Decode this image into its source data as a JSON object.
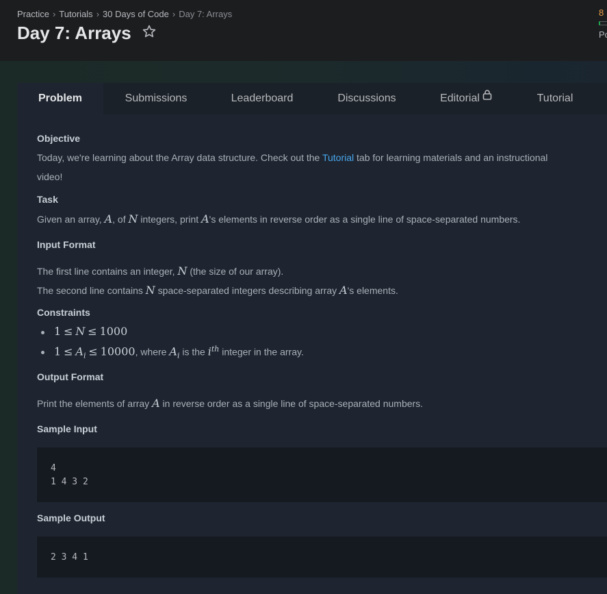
{
  "breadcrumb": {
    "items": [
      "Practice",
      "Tutorials",
      "30 Days of Code"
    ],
    "current": "Day 7: Arrays"
  },
  "title": "Day 7: Arrays",
  "stats": {
    "rank_fragment": "8",
    "points_fragment": "Po"
  },
  "tabs": [
    {
      "label": "Problem",
      "active": true
    },
    {
      "label": "Submissions"
    },
    {
      "label": "Leaderboard"
    },
    {
      "label": "Discussions"
    },
    {
      "label": "Editorial",
      "icon": "lock-icon"
    },
    {
      "label": "Tutorial"
    }
  ],
  "problem": {
    "objective": {
      "heading": "Objective",
      "text_before": "Today, we're learning about the Array data structure. Check out the ",
      "link": "Tutorial",
      "text_after": " tab for learning materials and an instructional",
      "text_line2": "video!"
    },
    "task": {
      "heading": "Task",
      "t1": "Given an array, ",
      "m1": "A",
      "t2": ", of ",
      "m2": "N",
      "t3": " integers, print ",
      "m3": "A",
      "t4": "'s elements in reverse order as a single line of space-separated numbers."
    },
    "input_format": {
      "heading": "Input Format",
      "l1a": "The first line contains an integer, ",
      "l1m": "N",
      "l1b": " (the size of our array).",
      "l2a": "The second line contains ",
      "l2m": "N",
      "l2b": " space-separated integers describing array ",
      "l2m2": "A",
      "l2c": "'s elements."
    },
    "constraints": {
      "heading": "Constraints",
      "c1": [
        "1",
        "≤",
        "N",
        "≤",
        "1000"
      ],
      "c2_parts": {
        "one": "1",
        "le1": "≤",
        "ai": "A",
        "sub": "i",
        "le2": "≤",
        "max": "10000",
        "where": ", where ",
        "ai2": "A",
        "sub2": "i",
        "isthe": " is the ",
        "ith": "i",
        "sup": "th",
        "tail": " integer in the array."
      }
    },
    "output_format": {
      "heading": "Output Format",
      "t1": "Print the elements of array ",
      "m": "A",
      "t2": " in reverse order as a single line of space-separated numbers."
    },
    "sample_input": {
      "heading": "Sample Input",
      "lines": [
        "4",
        "1 4 3 2"
      ]
    },
    "sample_output": {
      "heading": "Sample Output",
      "lines": [
        "2 3 4 1"
      ]
    }
  },
  "colors": {
    "accent_link": "#48a7ef",
    "rank": "#e89e4a",
    "progress": "#1ba94c"
  }
}
